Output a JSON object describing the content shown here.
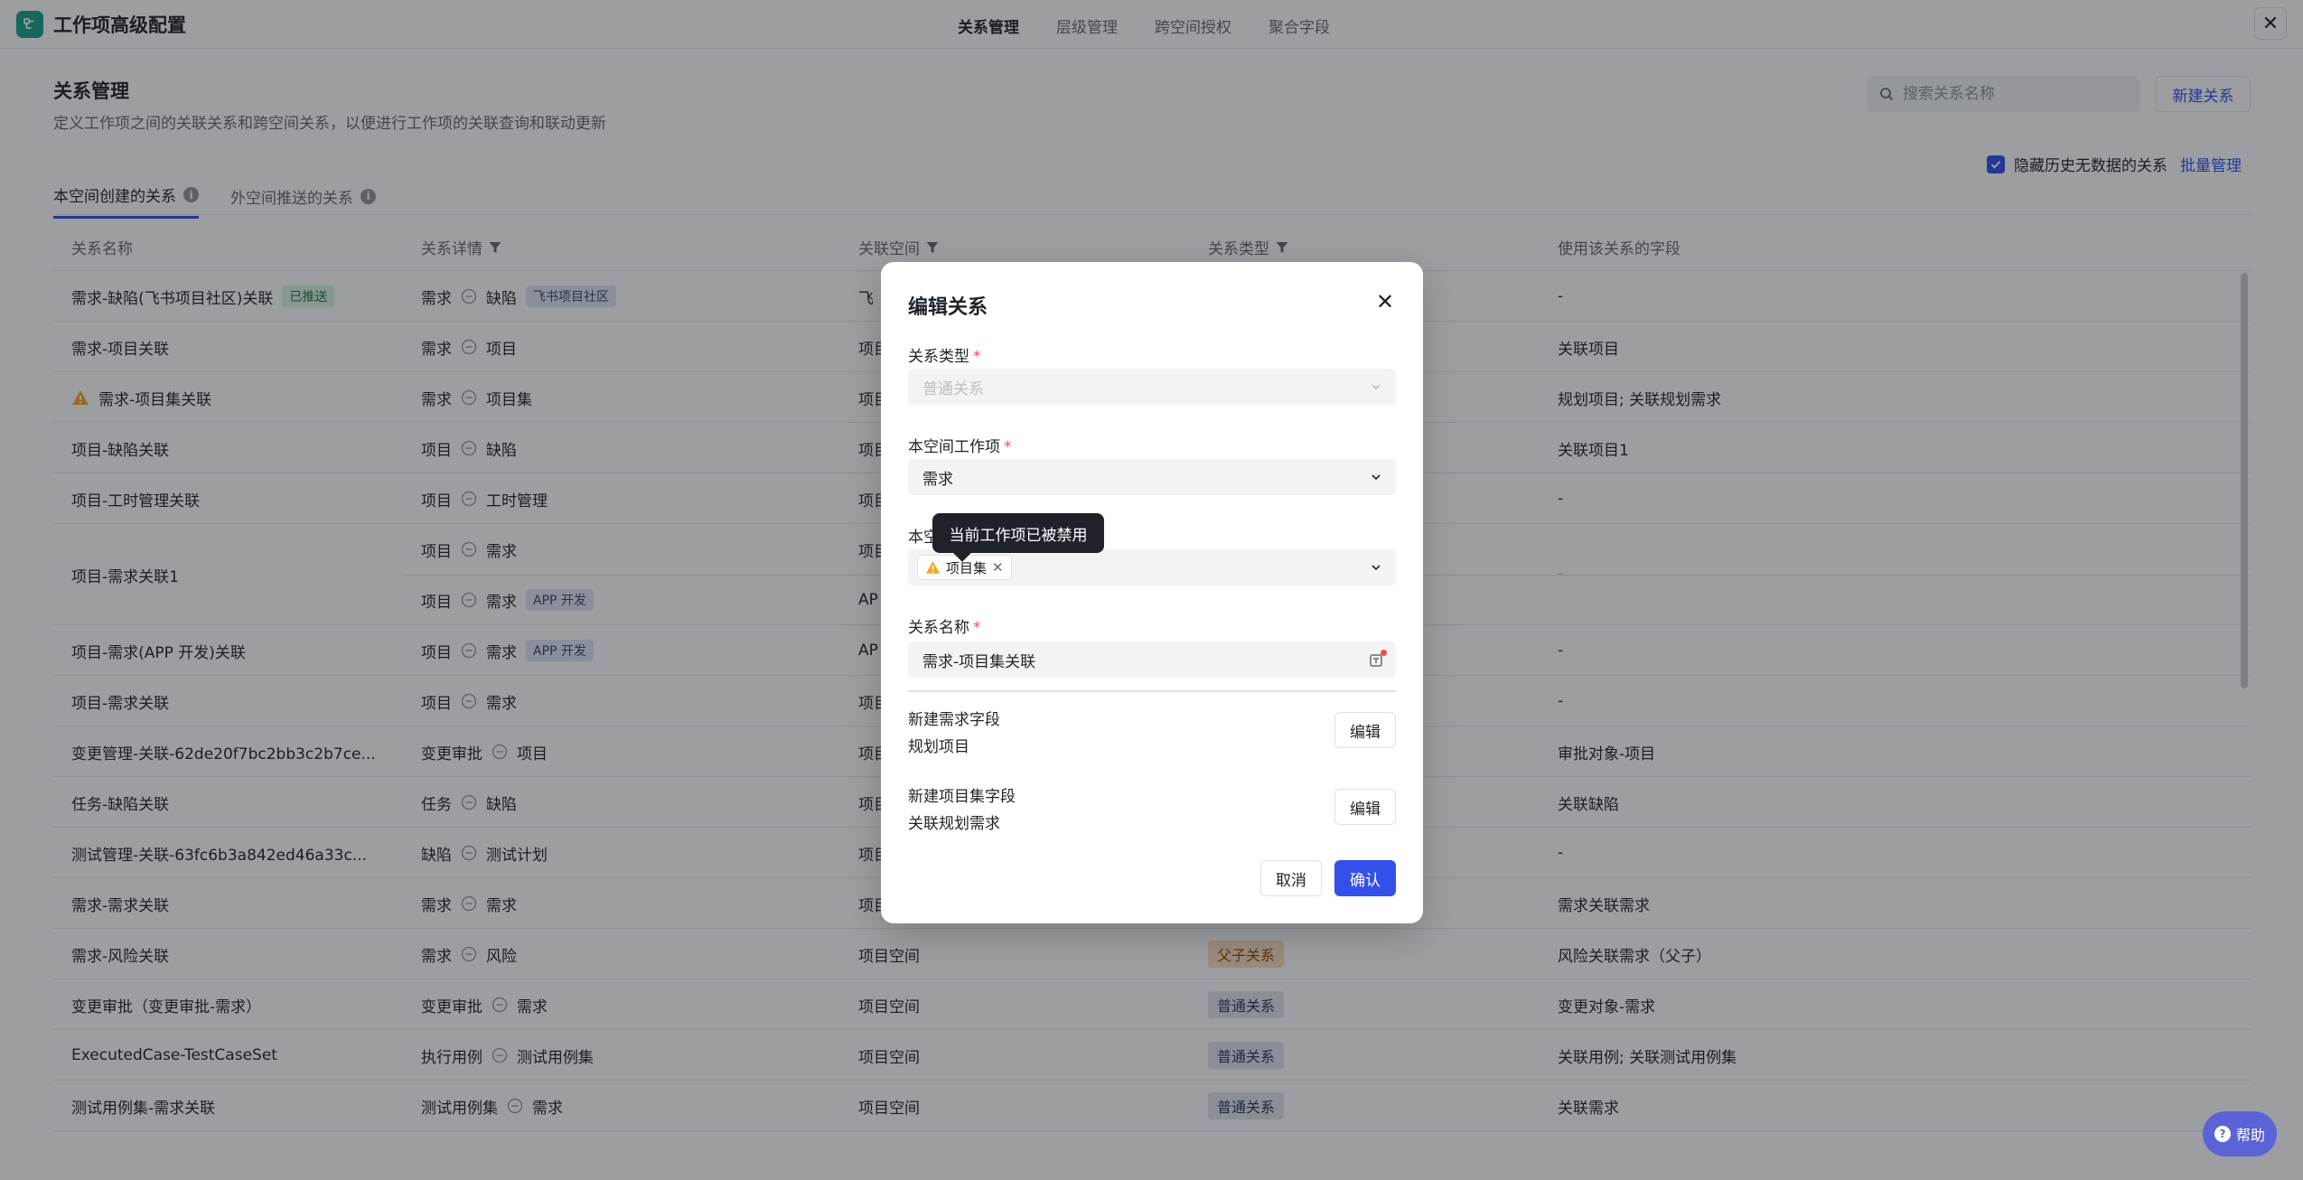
{
  "app": {
    "title": "工作项高级配置"
  },
  "top_tabs": [
    {
      "label": "关系管理",
      "active": true
    },
    {
      "label": "层级管理",
      "active": false
    },
    {
      "label": "跨空间授权",
      "active": false
    },
    {
      "label": "聚合字段",
      "active": false
    }
  ],
  "page": {
    "title": "关系管理",
    "description": "定义工作项之间的关联关系和跨空间关系，以便进行工作项的关联查询和联动更新",
    "search_placeholder": "搜索关系名称",
    "new_button": "新建关系",
    "hide_checkbox_label": "隐藏历史无数据的关系",
    "batch_manage": "批量管理"
  },
  "sub_tabs": [
    {
      "label": "本空间创建的关系",
      "active": true
    },
    {
      "label": "外空间推送的关系",
      "active": false
    }
  ],
  "table": {
    "headers": [
      "关系名称",
      "关系详情",
      "关联空间",
      "关系类型",
      "使用该关系的字段"
    ],
    "rows": [
      {
        "name": "需求-缺陷(飞书项目社区)关联",
        "name_tag": "已推送",
        "from": "需求",
        "to": "缺陷",
        "to_tag": "飞书项目社区",
        "space": "飞",
        "type": "",
        "fields": "-"
      },
      {
        "name": "需求-项目关联",
        "from": "需求",
        "to": "项目",
        "space": "项目",
        "type": "",
        "fields": "关联项目"
      },
      {
        "name": "需求-项目集关联",
        "warn": true,
        "from": "需求",
        "to": "项目集",
        "space": "项目",
        "type": "",
        "fields": "规划项目; 关联规划需求"
      },
      {
        "name": "项目-缺陷关联",
        "from": "项目",
        "to": "缺陷",
        "space": "项目",
        "type": "",
        "fields": "关联项目1"
      },
      {
        "name": "项目-工时管理关联",
        "from": "项目",
        "to": "工时管理",
        "space": "项目",
        "type": "",
        "fields": "-"
      }
    ],
    "merged_row": {
      "name": "项目-需求关联1",
      "a_from": "项目",
      "a_to": "需求",
      "a_space": "项目",
      "b_from": "项目",
      "b_to": "需求",
      "b_tag": "APP 开发",
      "b_space": "AP",
      "fields": "-"
    },
    "rows2": [
      {
        "name": "项目-需求(APP 开发)关联",
        "from": "项目",
        "to": "需求",
        "to_tag": "APP 开发",
        "space": "AP",
        "type": "",
        "fields": "-"
      },
      {
        "name": "项目-需求关联",
        "from": "项目",
        "to": "需求",
        "space": "项目",
        "type": "",
        "fields": "-"
      },
      {
        "name": "变更管理-关联-62de20f7bc2bb3c2b7ce...",
        "from": "变更审批",
        "to": "项目",
        "space": "项目",
        "type": "",
        "fields": "审批对象-项目"
      },
      {
        "name": "任务-缺陷关联",
        "from": "任务",
        "to": "缺陷",
        "space": "项目",
        "type": "",
        "fields": "关联缺陷"
      },
      {
        "name": "测试管理-关联-63fc6b3a842ed46a33c...",
        "from": "缺陷",
        "to": "测试计划",
        "space": "项目",
        "type": "",
        "fields": "-"
      },
      {
        "name": "需求-需求关联",
        "from": "需求",
        "to": "需求",
        "space": "项目",
        "type": "",
        "fields": "需求关联需求"
      },
      {
        "name": "需求-风险关联",
        "from": "需求",
        "to": "风险",
        "space": "项目空间",
        "type": "父子关系",
        "type_kind": "orange",
        "fields": "风险关联需求（父子）"
      },
      {
        "name": "变更审批（变更审批-需求）",
        "from": "变更审批",
        "to": "需求",
        "space": "项目空间",
        "type": "普通关系",
        "type_kind": "normal",
        "fields": "变更对象-需求"
      },
      {
        "name": "ExecutedCase-TestCaseSet",
        "from": "执行用例",
        "to": "测试用例集",
        "space": "项目空间",
        "type": "普通关系",
        "type_kind": "normal",
        "fields": "关联用例; 关联测试用例集"
      },
      {
        "name": "测试用例集-需求关联",
        "from": "测试用例集",
        "to": "需求",
        "space": "项目空间",
        "type": "普通关系",
        "type_kind": "normal",
        "fields": "关联需求"
      }
    ]
  },
  "modal": {
    "title": "编辑关系",
    "relation_type_label": "关系类型",
    "relation_type_value": "普通关系",
    "local_item_label": "本空间工作项",
    "local_item_value": "需求",
    "target_label": "本空",
    "target_chip": "项目集",
    "tooltip": "当前工作项已被禁用",
    "name_label": "关系名称",
    "name_value": "需求-项目集关联",
    "field1_title": "新建需求字段",
    "field1_value": "规划项目",
    "field2_title": "新建项目集字段",
    "field2_value": "关联规划需求",
    "edit_label": "编辑",
    "cancel_label": "取消",
    "confirm_label": "确认"
  },
  "help": {
    "label": "帮助"
  },
  "colors": {
    "accent": "#3350eb",
    "logo": "#1aa08a",
    "warning": "#f5a623"
  }
}
